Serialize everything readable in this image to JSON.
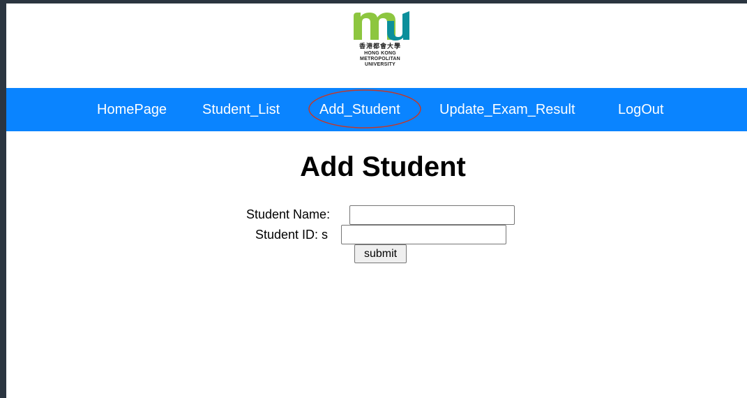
{
  "logo": {
    "chinese": "香港都會大學",
    "english_lines": [
      "HONG KONG",
      "METROPOLITAN",
      "UNIVERSITY"
    ],
    "colors": {
      "green": "#8dc63f",
      "teal": "#0b8f9b"
    }
  },
  "nav": {
    "background": "#0a84ff",
    "items": [
      {
        "label": "HomePage"
      },
      {
        "label": "Student_List"
      },
      {
        "label": "Add_Student",
        "highlighted": true
      },
      {
        "label": "Update_Exam_Result"
      },
      {
        "label": "LogOut"
      }
    ],
    "highlight_color": "#c0392b"
  },
  "main": {
    "title": "Add Student",
    "form": {
      "name_label": "Student Name:",
      "name_value": "",
      "id_label": "Student ID: s",
      "id_value": "",
      "submit_label": "submit"
    }
  }
}
